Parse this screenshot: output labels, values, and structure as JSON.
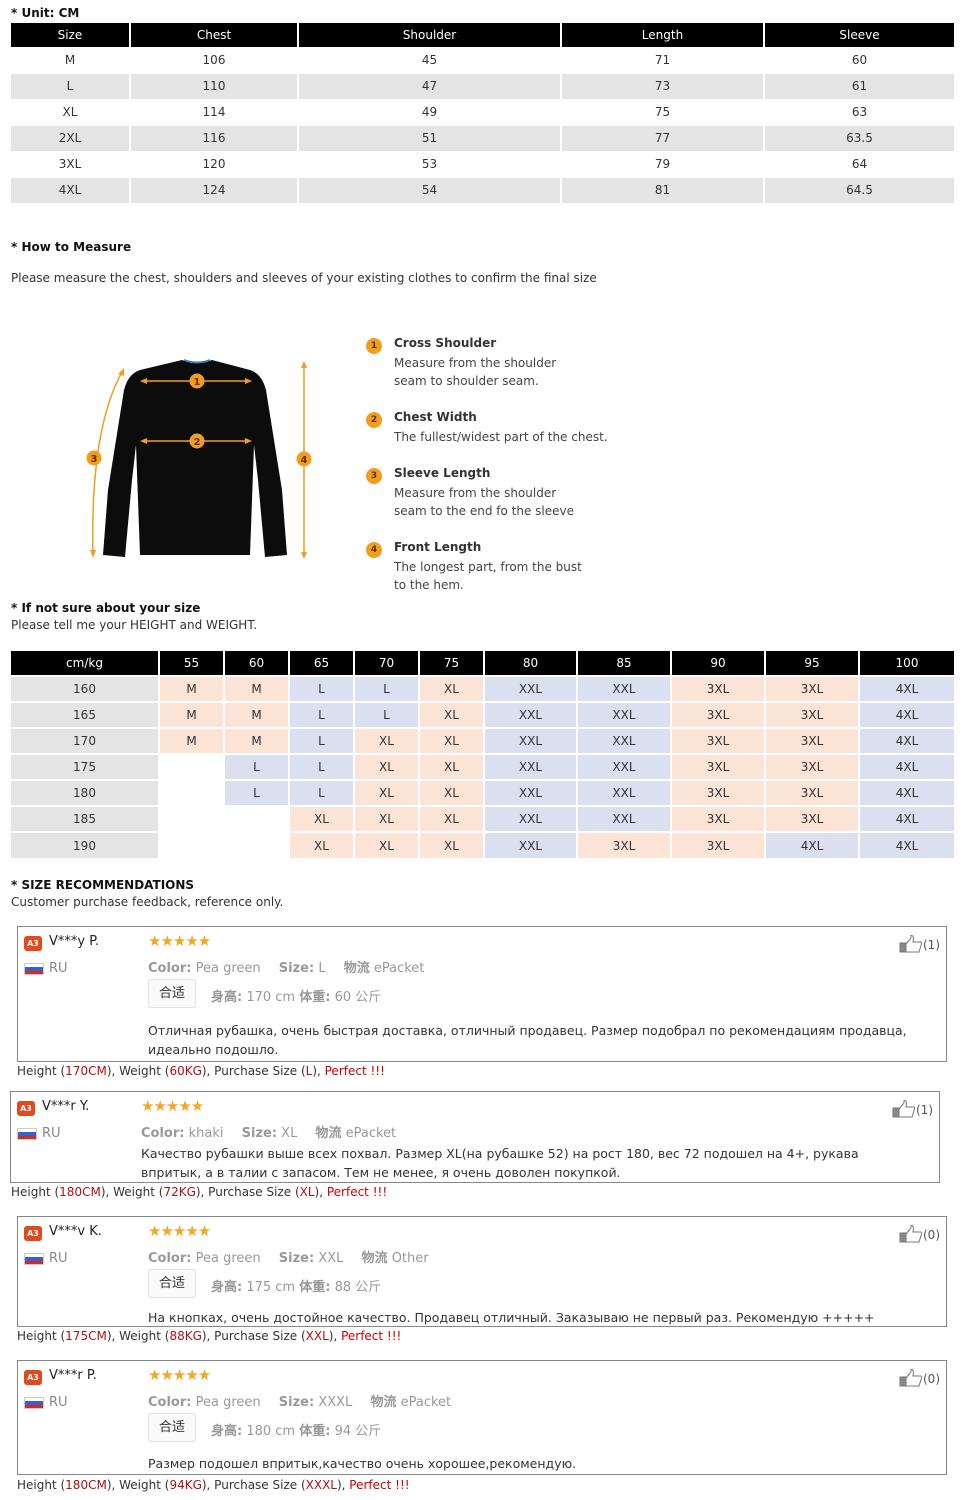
{
  "size_chart": {
    "unit_label": "* Unit: CM",
    "headers": [
      "Size",
      "Chest",
      "Shoulder",
      "Length",
      "Sleeve"
    ],
    "rows": [
      [
        "M",
        "106",
        "45",
        "71",
        "60"
      ],
      [
        "L",
        "110",
        "47",
        "73",
        "61"
      ],
      [
        "XL",
        "114",
        "49",
        "75",
        "63"
      ],
      [
        "2XL",
        "116",
        "51",
        "77",
        "63.5"
      ],
      [
        "3XL",
        "120",
        "53",
        "79",
        "64"
      ],
      [
        "4XL",
        "124",
        "54",
        "81",
        "64.5"
      ]
    ]
  },
  "how_to_measure": {
    "title": "* How to Measure",
    "text": "Please measure the chest, shoulders and sleeves of your existing clothes to confirm the final size",
    "diagram_markers": [
      "1",
      "2",
      "3",
      "4"
    ],
    "accent_color": "#f39c1e",
    "items": [
      {
        "num": "1",
        "title": "Cross Shoulder",
        "desc": "Measure from the shoulder seam to shoulder seam."
      },
      {
        "num": "2",
        "title": "Chest Width",
        "desc": "The fullest/widest part of the chest."
      },
      {
        "num": "3",
        "title": "Sleeve Length",
        "desc": "Measure from the shoulder seam to the end fo the sleeve"
      },
      {
        "num": "4",
        "title": "Front Length",
        "desc": "The longest part, from the bust to the hem."
      }
    ]
  },
  "not_sure": {
    "title": "* If not sure about your size",
    "text": "Please tell me your HEIGHT and WEIGHT."
  },
  "hw_chart": {
    "corner": "cm/kg",
    "weights": [
      "55",
      "60",
      "65",
      "70",
      "75",
      "80",
      "85",
      "90",
      "95",
      "100"
    ],
    "rows": [
      {
        "height": "160",
        "cells": [
          [
            "M",
            "o"
          ],
          [
            "M",
            "o"
          ],
          [
            "L",
            "b"
          ],
          [
            "L",
            "b"
          ],
          [
            "XL",
            "o"
          ],
          [
            "XXL",
            "b"
          ],
          [
            "XXL",
            "b"
          ],
          [
            "3XL",
            "o"
          ],
          [
            "3XL",
            "o"
          ],
          [
            "4XL",
            "b"
          ]
        ]
      },
      {
        "height": "165",
        "cells": [
          [
            "M",
            "o"
          ],
          [
            "M",
            "o"
          ],
          [
            "L",
            "b"
          ],
          [
            "L",
            "b"
          ],
          [
            "XL",
            "o"
          ],
          [
            "XXL",
            "b"
          ],
          [
            "XXL",
            "b"
          ],
          [
            "3XL",
            "o"
          ],
          [
            "3XL",
            "o"
          ],
          [
            "4XL",
            "b"
          ]
        ]
      },
      {
        "height": "170",
        "cells": [
          [
            "M",
            "o"
          ],
          [
            "M",
            "o"
          ],
          [
            "L",
            "b"
          ],
          [
            "XL",
            "o"
          ],
          [
            "XL",
            "o"
          ],
          [
            "XXL",
            "b"
          ],
          [
            "XXL",
            "b"
          ],
          [
            "3XL",
            "o"
          ],
          [
            "3XL",
            "o"
          ],
          [
            "4XL",
            "b"
          ]
        ]
      },
      {
        "height": "175",
        "cells": [
          [
            "",
            "e"
          ],
          [
            "L",
            "b"
          ],
          [
            "L",
            "b"
          ],
          [
            "XL",
            "o"
          ],
          [
            "XL",
            "o"
          ],
          [
            "XXL",
            "b"
          ],
          [
            "XXL",
            "b"
          ],
          [
            "3XL",
            "o"
          ],
          [
            "3XL",
            "o"
          ],
          [
            "4XL",
            "b"
          ]
        ]
      },
      {
        "height": "180",
        "cells": [
          [
            "",
            "e"
          ],
          [
            "L",
            "b"
          ],
          [
            "L",
            "b"
          ],
          [
            "XL",
            "o"
          ],
          [
            "XL",
            "o"
          ],
          [
            "XXL",
            "b"
          ],
          [
            "XXL",
            "b"
          ],
          [
            "3XL",
            "o"
          ],
          [
            "3XL",
            "o"
          ],
          [
            "4XL",
            "b"
          ]
        ]
      },
      {
        "height": "185",
        "cells": [
          [
            "",
            "e"
          ],
          [
            "",
            "e"
          ],
          [
            "XL",
            "o"
          ],
          [
            "XL",
            "o"
          ],
          [
            "XL",
            "o"
          ],
          [
            "XXL",
            "b"
          ],
          [
            "XXL",
            "b"
          ],
          [
            "3XL",
            "o"
          ],
          [
            "3XL",
            "o"
          ],
          [
            "4XL",
            "b"
          ]
        ]
      },
      {
        "height": "190",
        "cells": [
          [
            "",
            "e"
          ],
          [
            "",
            "e"
          ],
          [
            "XL",
            "o"
          ],
          [
            "XL",
            "o"
          ],
          [
            "XL",
            "o"
          ],
          [
            "XXL",
            "b"
          ],
          [
            "3XL",
            "o"
          ],
          [
            "3XL",
            "o"
          ],
          [
            "4XL",
            "b"
          ],
          [
            "4XL",
            "b"
          ]
        ]
      }
    ]
  },
  "recommendations": {
    "title": "* SIZE RECOMMENDATIONS",
    "text": "Customer purchase feedback, reference only.",
    "labels": {
      "color": "Color:",
      "size": "Size:",
      "logistics": "物流",
      "fit_button": "合适",
      "height": "身高:",
      "weight": "体重:",
      "badge": "A3",
      "stars": "★★★★★",
      "sum_height": "Height (",
      "sum_weight": "), Weight (",
      "sum_size": "), Purchase Size (",
      "sum_close": "), "
    },
    "reviews": [
      {
        "user": "V***y P.",
        "country": "RU",
        "rating": 5,
        "color": "Pea green",
        "size": "L",
        "logistics": "ePacket",
        "height": "170 cm",
        "weight": "60 公斤",
        "text": "Отличная рубашка, очень быстрая доставка, отличный продавец. Размер подобрал по рекомендациям продавца, идеально подошло.",
        "likes": "(1)",
        "sum_height": "170CM",
        "sum_weight": "60KG",
        "sum_size": "L",
        "verdict": "Perfect !!!"
      },
      {
        "user": "V***r Y.",
        "country": "RU",
        "rating": 5,
        "color": "khaki",
        "size": "XL",
        "logistics": "ePacket",
        "text": "Качество рубашки выше всех похвал. Размер XL(на рубашке 52) на рост 180, вес 72 подошел на 4+, рукава впритык, а в талии с запасом. Тем не менее, я очень доволен покупкой.",
        "likes": "(1)",
        "sum_height": "180CM",
        "sum_weight": "72KG",
        "sum_size": "XL",
        "verdict": "Perfect !!!"
      },
      {
        "user": "V***v K.",
        "country": "RU",
        "rating": 5,
        "color": "Pea green",
        "size": "XXL",
        "logistics": "Other",
        "height": "175 cm",
        "weight": "88 公斤",
        "text": "На кнопках, очень достойное качество. Продавец отличный. Заказываю не первый раз. Рекомендую +++++",
        "likes": "(0)",
        "sum_height": "175CM",
        "sum_weight": "88KG",
        "sum_size": "XXL",
        "verdict": "Perfect !!!"
      },
      {
        "user": "V***r P.",
        "country": "RU",
        "rating": 5,
        "color": "Pea green",
        "size": "XXXL",
        "logistics": "ePacket",
        "height": "180 cm",
        "weight": "94 公斤",
        "text": "Размер подошел впритык,качество очень хорошее,рекомендую.",
        "likes": "(0)",
        "sum_height": "180CM",
        "sum_weight": "94KG",
        "sum_size": "XXXL",
        "verdict": "Perfect !!!"
      }
    ]
  }
}
